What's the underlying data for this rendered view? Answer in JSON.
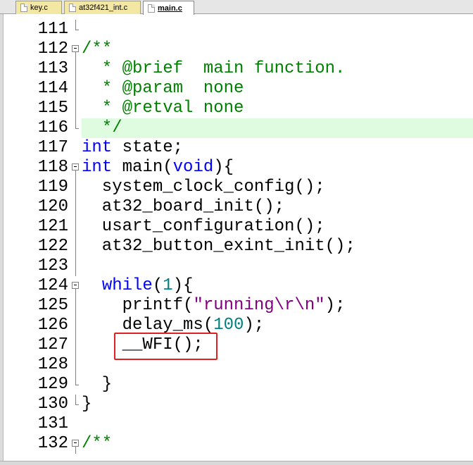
{
  "tabs": [
    {
      "label": "key.c",
      "active": false
    },
    {
      "label": "at32f421_int.c",
      "active": false
    },
    {
      "label": "main.c",
      "active": true
    }
  ],
  "colors": {
    "comment": "#008000",
    "keyword": "#0000ff",
    "number": "#008080",
    "string": "#800080",
    "current_line_highlight": "#e0fce0",
    "annotation_box": "#e02020",
    "modified_tab": "#f3e7a4"
  },
  "editor": {
    "highlighted_line": "116",
    "annotated_line": "127",
    "lines": [
      {
        "num": "111",
        "fold": "end",
        "tokens": []
      },
      {
        "num": "112",
        "fold": "open",
        "tokens": [
          {
            "t": "/**",
            "c": "cm"
          }
        ]
      },
      {
        "num": "113",
        "fold": "line",
        "tokens": [
          {
            "t": "  * @brief  main function.",
            "c": "cm"
          }
        ]
      },
      {
        "num": "114",
        "fold": "line",
        "tokens": [
          {
            "t": "  * @param  none",
            "c": "cm"
          }
        ]
      },
      {
        "num": "115",
        "fold": "line",
        "tokens": [
          {
            "t": "  * @retval none",
            "c": "cm"
          }
        ]
      },
      {
        "num": "116",
        "fold": "end",
        "tokens": [
          {
            "t": "  */",
            "c": "cm"
          }
        ]
      },
      {
        "num": "117",
        "fold": "",
        "tokens": [
          {
            "t": "int",
            "c": "kw"
          },
          {
            "t": " state;",
            "c": ""
          }
        ]
      },
      {
        "num": "118",
        "fold": "open",
        "tokens": [
          {
            "t": "int",
            "c": "kw"
          },
          {
            "t": " main(",
            "c": ""
          },
          {
            "t": "void",
            "c": "kw"
          },
          {
            "t": "){",
            "c": ""
          }
        ]
      },
      {
        "num": "119",
        "fold": "line",
        "tokens": [
          {
            "t": "  system_clock_config();",
            "c": ""
          }
        ]
      },
      {
        "num": "120",
        "fold": "line",
        "tokens": [
          {
            "t": "  at32_board_init();",
            "c": ""
          }
        ]
      },
      {
        "num": "121",
        "fold": "line",
        "tokens": [
          {
            "t": "  usart_configuration();",
            "c": ""
          }
        ]
      },
      {
        "num": "122",
        "fold": "line",
        "tokens": [
          {
            "t": "  at32_button_exint_init();",
            "c": ""
          }
        ]
      },
      {
        "num": "123",
        "fold": "line",
        "tokens": []
      },
      {
        "num": "124",
        "fold": "open",
        "tokens": [
          {
            "t": "  ",
            "c": ""
          },
          {
            "t": "while",
            "c": "kw"
          },
          {
            "t": "(",
            "c": ""
          },
          {
            "t": "1",
            "c": "num"
          },
          {
            "t": "){",
            "c": ""
          }
        ]
      },
      {
        "num": "125",
        "fold": "line",
        "tokens": [
          {
            "t": "    printf(",
            "c": ""
          },
          {
            "t": "\"running\\r\\n\"",
            "c": "str"
          },
          {
            "t": ");",
            "c": ""
          }
        ]
      },
      {
        "num": "126",
        "fold": "line",
        "tokens": [
          {
            "t": "    delay_ms(",
            "c": ""
          },
          {
            "t": "100",
            "c": "num"
          },
          {
            "t": ");",
            "c": ""
          }
        ]
      },
      {
        "num": "127",
        "fold": "line",
        "tokens": [
          {
            "t": "    __WFI();",
            "c": ""
          }
        ]
      },
      {
        "num": "128",
        "fold": "line",
        "tokens": []
      },
      {
        "num": "129",
        "fold": "end",
        "tokens": [
          {
            "t": "  }",
            "c": ""
          }
        ]
      },
      {
        "num": "130",
        "fold": "end",
        "tokens": [
          {
            "t": "}",
            "c": ""
          }
        ]
      },
      {
        "num": "131",
        "fold": "",
        "tokens": []
      },
      {
        "num": "132",
        "fold": "open",
        "tokens": [
          {
            "t": "/**",
            "c": "cm"
          }
        ]
      }
    ]
  }
}
